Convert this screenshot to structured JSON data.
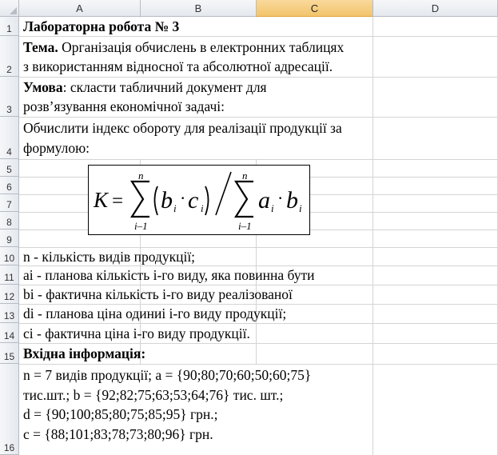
{
  "columns": [
    "A",
    "B",
    "C",
    "D"
  ],
  "rows": [
    "1",
    "2",
    "3",
    "4",
    "5",
    "6",
    "7",
    "8",
    "9",
    "10",
    "11",
    "12",
    "13",
    "14",
    "15",
    "16"
  ],
  "title": "Лабораторна робота № 3",
  "theme": {
    "label": "Тема.",
    "line1": " Організація обчислень в електронних таблицях",
    "line2": "з використанням відносної та абсолютної адресації."
  },
  "condition": {
    "label": "Умова",
    "line1": ": скласти табличний документ для",
    "line2": "розв’язування економічної задачі:"
  },
  "task": {
    "line1": "Обчислити індекс обороту для реалізації продукції за",
    "line2": "формулою:"
  },
  "formula": {
    "K": "K",
    "eq": "=",
    "sum_top": "n",
    "sum_bottom": "i–1",
    "num_b": "b",
    "num_c": "c",
    "sub_i": "i",
    "den_a": "a",
    "den_b": "b",
    "dot": "·"
  },
  "definitions": [
    "n - кількість видів продукції;",
    "ai - планова кількість і-го виду, яка повинна бути",
    "bi - фактична кількість і-го виду реалізованої",
    "di - планова ціна одиниі і-го виду продукції;",
    "ci - фактична ціна і-го виду продукції."
  ],
  "input_header": "Вхідна інформація:",
  "input_lines": [
    "n = 7 видів продукції; a = {90;80;70;60;50;60;75}",
    "тис.шт.; b = {92;82;75;63;53;64;76} тис. шт.;",
    "d = {90;100;85;80;75;85;95} грн.;",
    "c = {88;101;83;78;73;80;96} грн."
  ]
}
